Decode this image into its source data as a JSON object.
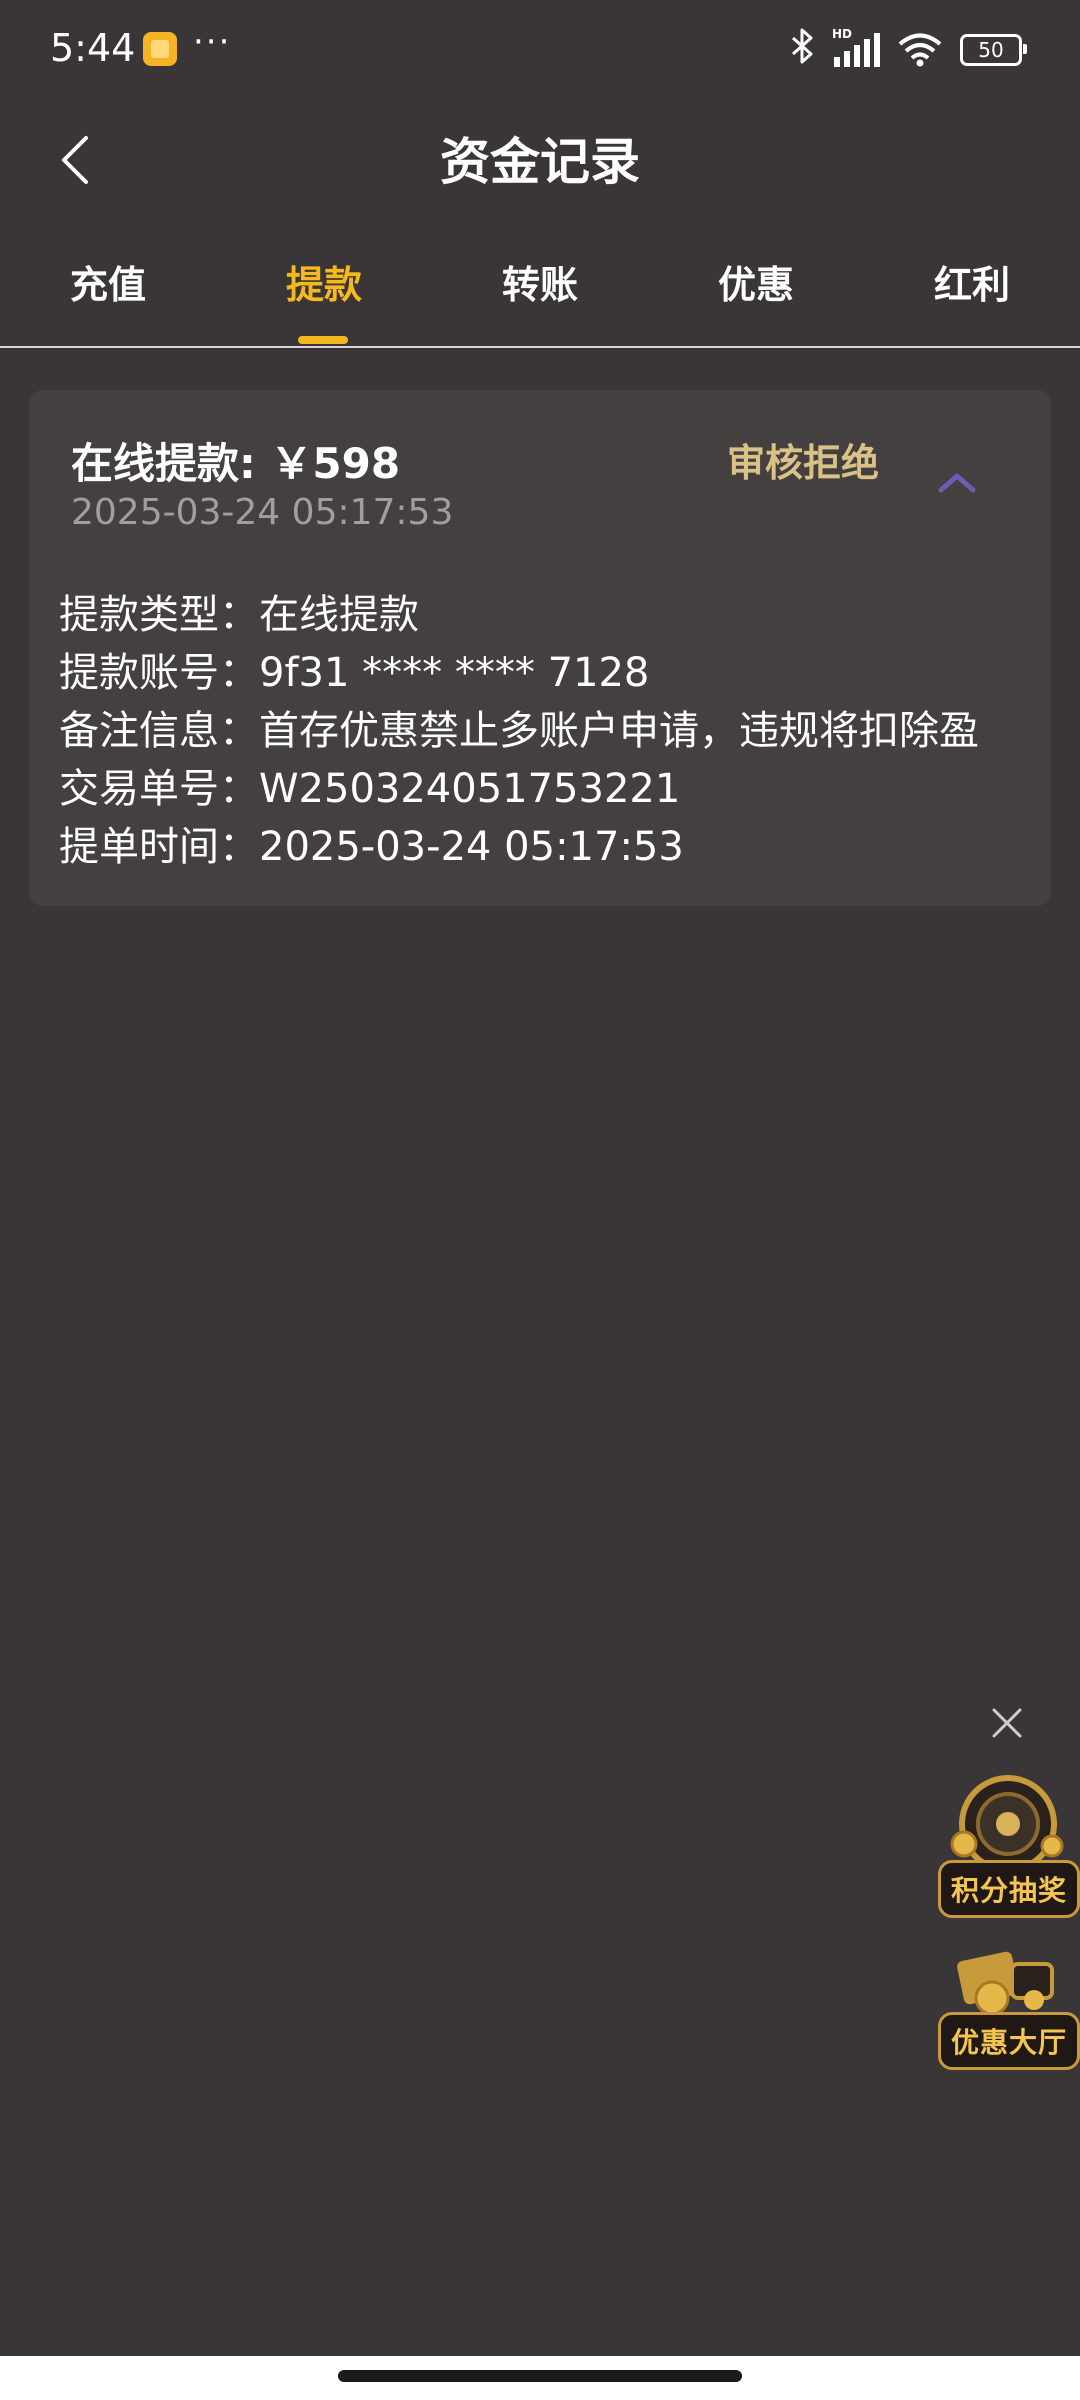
{
  "status_bar": {
    "time": "5:44",
    "dots": "···",
    "battery": "50",
    "hd": "HD",
    "icons": [
      "app-notification-icon",
      "bluetooth-icon",
      "signal-icon",
      "wifi-icon",
      "battery-icon"
    ]
  },
  "header": {
    "title": "资金记录",
    "back_icon": "chevron-left-icon"
  },
  "tabs": [
    {
      "label": "充值",
      "active": false
    },
    {
      "label": "提款",
      "active": true
    },
    {
      "label": "转账",
      "active": false
    },
    {
      "label": "优惠",
      "active": false
    },
    {
      "label": "红利",
      "active": false
    }
  ],
  "record": {
    "title": "在线提款: ￥598",
    "status": "审核拒绝",
    "date": "2025-03-24 05:17:53",
    "details": [
      {
        "label": "提款类型：",
        "value": "在线提款"
      },
      {
        "label": "提款账号：",
        "value": "9f31 **** **** 7128"
      },
      {
        "label": "备注信息：",
        "value": "首存优惠禁止多账户申请，违规将扣除盈"
      },
      {
        "label": "交易单号：",
        "value": "W250324051753221"
      },
      {
        "label": "提单时间：",
        "value": "2025-03-24 05:17:53"
      }
    ]
  },
  "floating": {
    "close_icon": "close-icon",
    "lottery_label": "积分抽奖",
    "promo_label": "优惠大厅"
  },
  "colors": {
    "background": "#3a3536",
    "card": "#444040",
    "accent": "#f5b81f",
    "status": "#d9c187",
    "collapse_arrow": "#6d5bb5"
  }
}
